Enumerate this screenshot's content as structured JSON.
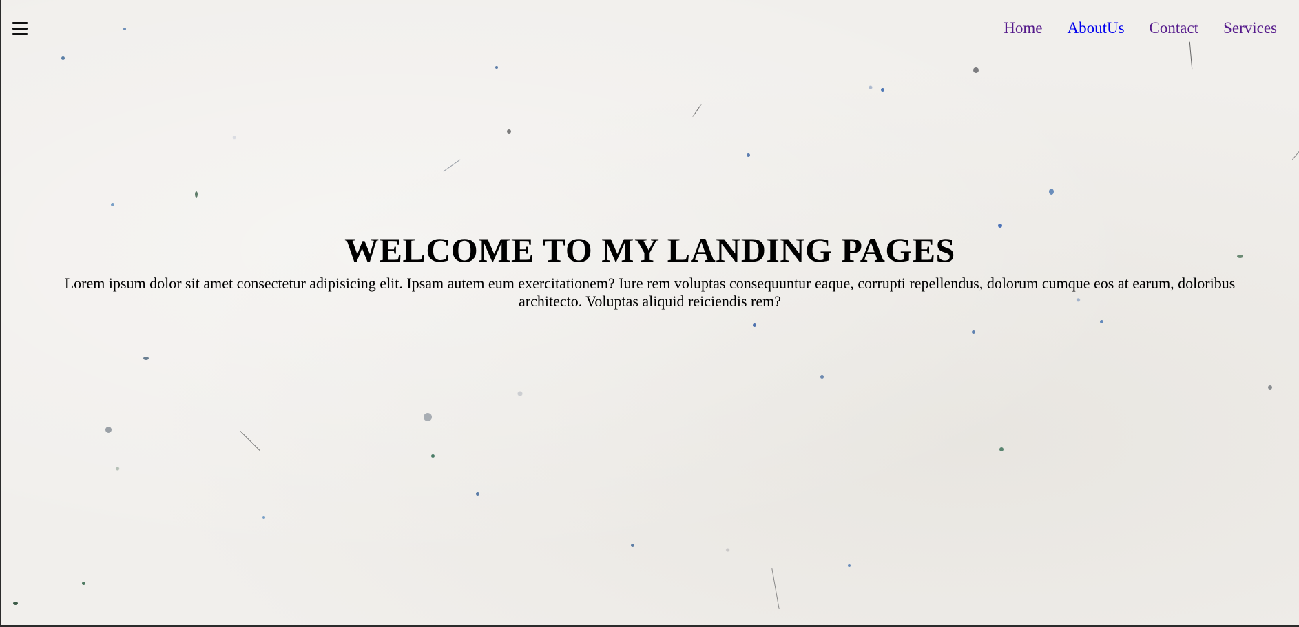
{
  "nav": {
    "menu_icon": "hamburger-menu-icon",
    "links": [
      {
        "label": "Home",
        "color": "#551a8b"
      },
      {
        "label": "AboutUs",
        "color": "#0000ee"
      },
      {
        "label": "Contact",
        "color": "#551a8b"
      },
      {
        "label": "Services",
        "color": "#551a8b"
      }
    ]
  },
  "hero": {
    "title": "WELCOME TO MY LANDING PAGES",
    "description": "Lorem ipsum dolor sit amet consectetur adipisicing elit. Ipsam autem eum exercitationem? Iure rem voluptas consequuntur eaque, corrupti repellendus, dolorum cumque eos at earum, doloribus architecto. Voluptas aliquid reiciendis rem?"
  },
  "theme": {
    "background": "#f1efec",
    "text": "#000000",
    "link_visited": "#551a8b",
    "link": "#0000ee"
  }
}
